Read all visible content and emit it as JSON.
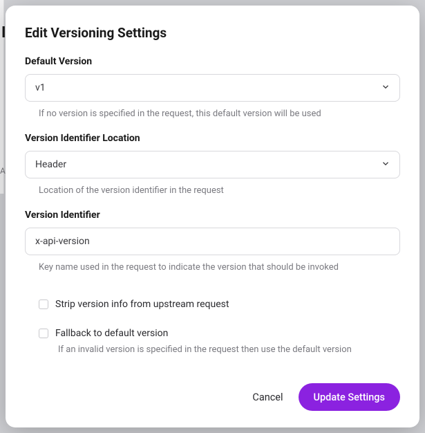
{
  "modal": {
    "title": "Edit Versioning Settings",
    "fields": {
      "default_version": {
        "label": "Default Version",
        "value": "v1",
        "hint": "If no version is specified in the request, this default version will be used"
      },
      "identifier_location": {
        "label": "Version Identifier Location",
        "value": "Header",
        "hint": "Location of the version identifier in the request"
      },
      "identifier": {
        "label": "Version Identifier",
        "value": "x-api-version",
        "hint": "Key name used in the request to indicate the version that should be invoked"
      },
      "strip": {
        "label": "Strip version info from upstream request",
        "checked": false
      },
      "fallback": {
        "label": "Fallback to default version",
        "hint": "If an invalid version is specified in the request then use the default version",
        "checked": false
      }
    },
    "footer": {
      "cancel": "Cancel",
      "submit": "Update Settings"
    }
  },
  "background": {
    "char": "I",
    "small": "A"
  },
  "colors": {
    "primary": "#8b22e0"
  }
}
